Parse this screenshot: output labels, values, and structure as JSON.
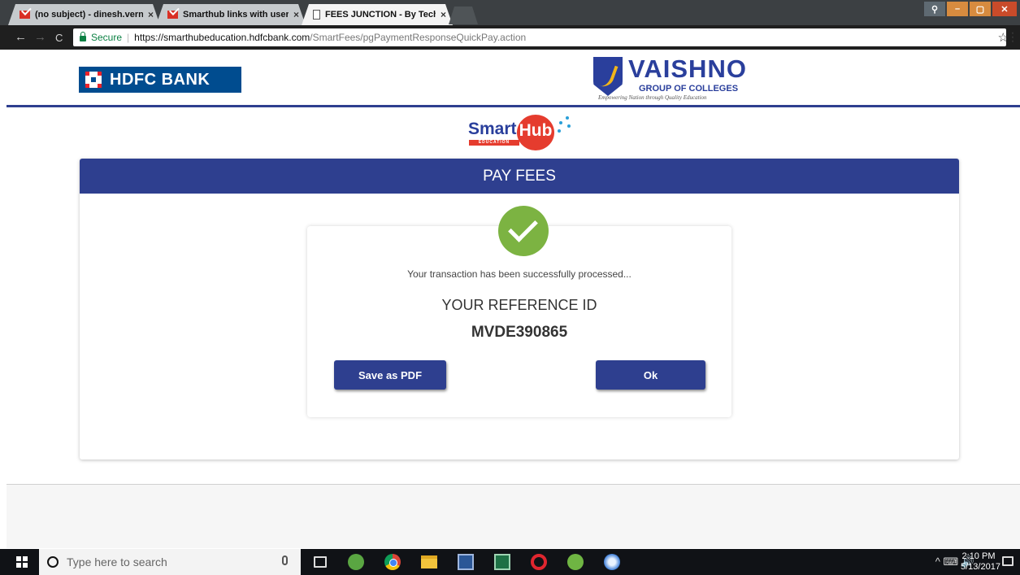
{
  "browser": {
    "tabs": [
      {
        "title": "(no subject) - dinesh.vern",
        "icon": "gmail-icon",
        "active": false
      },
      {
        "title": "Smarthub links with user",
        "icon": "gmail-icon",
        "active": false
      },
      {
        "title": "FEES JUNCTION - By Tech",
        "icon": "document-icon",
        "active": true
      }
    ],
    "tab_close": "×",
    "secure_label": "Secure",
    "url_host": "https://smarthubeducation.hdfcbank.com",
    "url_path": "/SmartFees/pgPaymentResponseQuickPay.action",
    "back": "←",
    "forward": "→",
    "reload": "C",
    "bookmark_star": "☆",
    "menu": "⋮"
  },
  "header": {
    "bank_name": "HDFC BANK",
    "college_name": "VAISHNO",
    "college_sub": "GROUP OF COLLEGES",
    "college_tagline": "Empowering Nation through Quality Education",
    "smarthub_left": "Smart",
    "smarthub_right": "Hub",
    "smarthub_edu": "EDUCATION"
  },
  "card": {
    "title": "PAY FEES",
    "message": "Your transaction has been successfully processed...",
    "ref_label": "YOUR REFERENCE ID",
    "ref_id": "MVDE390865",
    "save_pdf_label": "Save as PDF",
    "ok_label": "Ok"
  },
  "colors": {
    "brand_blue": "#2e3f8f",
    "success_green": "#7cb342",
    "hdfc_red": "#ed232a"
  },
  "taskbar": {
    "search_placeholder": "Type here to search",
    "tray": "^ ⌨ 🔊",
    "time": "2:10 PM",
    "date": "5/13/2017"
  }
}
